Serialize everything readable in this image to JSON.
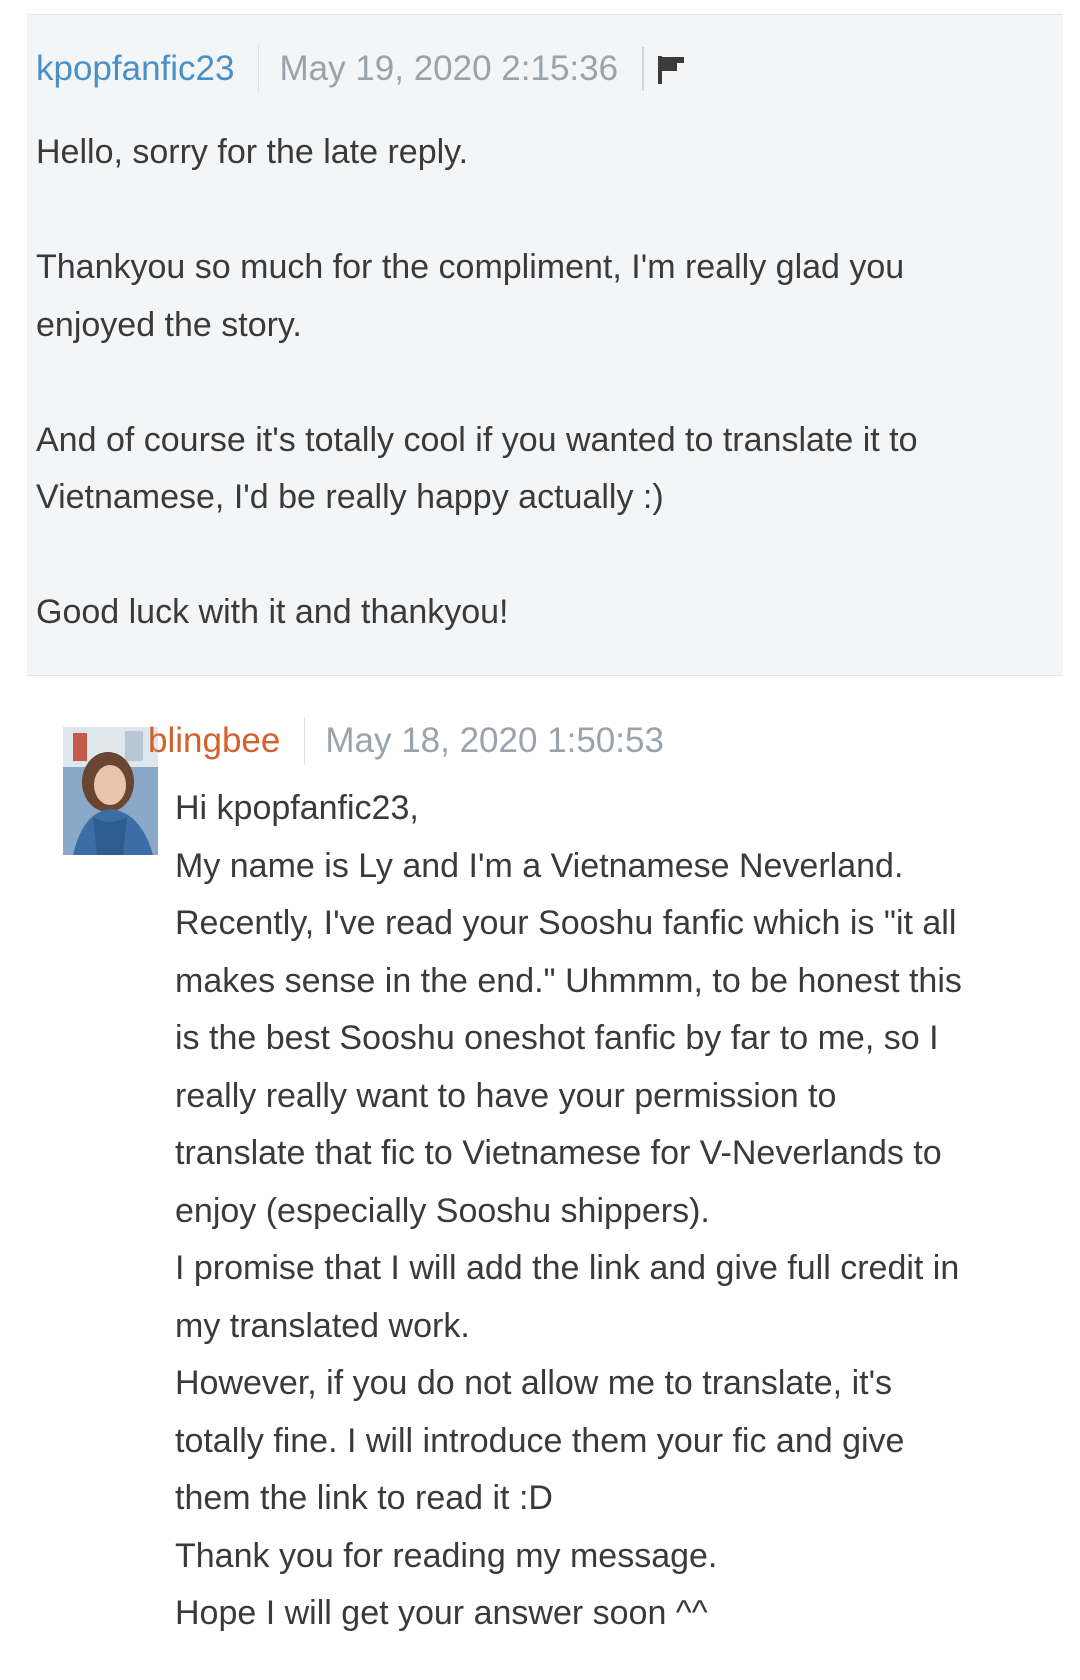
{
  "reply": {
    "author": "kpopfanfic23",
    "timestamp": "May 19, 2020 2:15:36",
    "paragraphs": [
      "Hello, sorry for the late reply.",
      "Thankyou so much for the compliment, I'm really glad you enjoyed the story.",
      "And of course it's totally cool if you wanted to translate it to Vietnamese, I'd be really happy actually :)",
      "Good luck with it and thankyou!"
    ]
  },
  "message": {
    "author": "blingbee",
    "timestamp": "May 18, 2020 1:50:53",
    "lines": [
      "Hi kpopfanfic23,",
      "My name is Ly and I'm a Vietnamese Neverland.",
      "Recently, I've read your Sooshu fanfic which is \"it all",
      "makes sense in the end.\" Uhmmm, to be honest this",
      "is the best Sooshu oneshot fanfic by far to me, so I",
      "really really want to have your permission to",
      "translate that fic to Vietnamese for V-Neverlands to",
      "enjoy (especially Sooshu shippers).",
      "I promise that I will add the link and give full credit in",
      "my translated work.",
      "However, if you do not allow me to translate, it's",
      "totally fine. I will introduce them your fic and give",
      "them the link to read it :D",
      "Thank you for reading my message.",
      "Hope I will get your answer soon ^^"
    ]
  },
  "colors": {
    "reply_bg": "#f3f5f7",
    "author_link": "#4a90c8",
    "author_link_alt": "#d2612c",
    "timestamp": "#9aa3ab",
    "body_text": "#3a3a3a"
  },
  "icons": [
    "flag-icon",
    "avatar"
  ]
}
